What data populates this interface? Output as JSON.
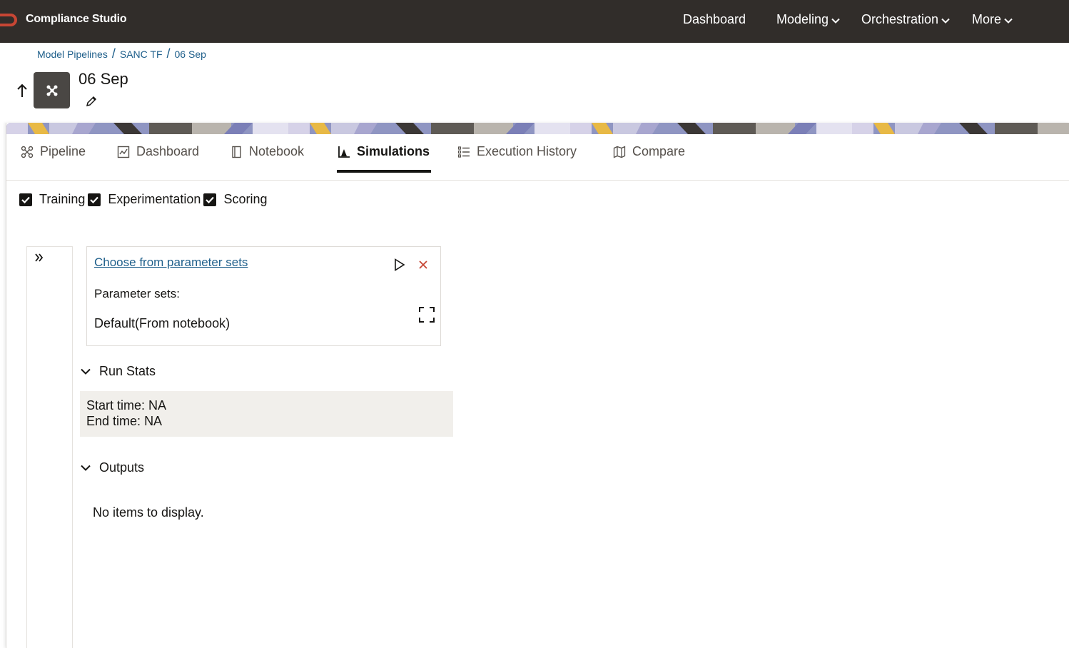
{
  "app": {
    "brand": "Compliance Studio",
    "colors": {
      "header_bg": "#312d2a",
      "logo_red": "#c74634",
      "link": "#1d5e8a",
      "stats_bg": "#f1efeb"
    }
  },
  "nav": {
    "dashboard": "Dashboard",
    "modeling": "Modeling",
    "orchestration": "Orchestration",
    "more": "More"
  },
  "breadcrumb": {
    "items": [
      "Model Pipelines",
      "SANC TF",
      "06 Sep"
    ],
    "separator": "/"
  },
  "page": {
    "title": "06 Sep",
    "icon": "pipeline-icon"
  },
  "tabs": [
    {
      "label": "Pipeline",
      "icon": "pipeline-icon"
    },
    {
      "label": "Dashboard",
      "icon": "dashboard-icon"
    },
    {
      "label": "Notebook",
      "icon": "notebook-icon"
    },
    {
      "label": "Simulations",
      "icon": "chart-icon",
      "active": true
    },
    {
      "label": "Execution History",
      "icon": "list-icon"
    },
    {
      "label": "Compare",
      "icon": "map-icon"
    }
  ],
  "filters": [
    {
      "label": "Training",
      "checked": true
    },
    {
      "label": "Experimentation",
      "checked": true
    },
    {
      "label": "Scoring",
      "checked": true
    }
  ],
  "param_card": {
    "link": "Choose from parameter sets",
    "label": "Parameter sets:",
    "value": "Default(From notebook)"
  },
  "run_stats": {
    "title": "Run Stats",
    "start_label": "Start time:",
    "start_value": "NA",
    "end_label": "End time:",
    "end_value": "NA"
  },
  "outputs": {
    "title": "Outputs",
    "empty": "No items to display."
  }
}
